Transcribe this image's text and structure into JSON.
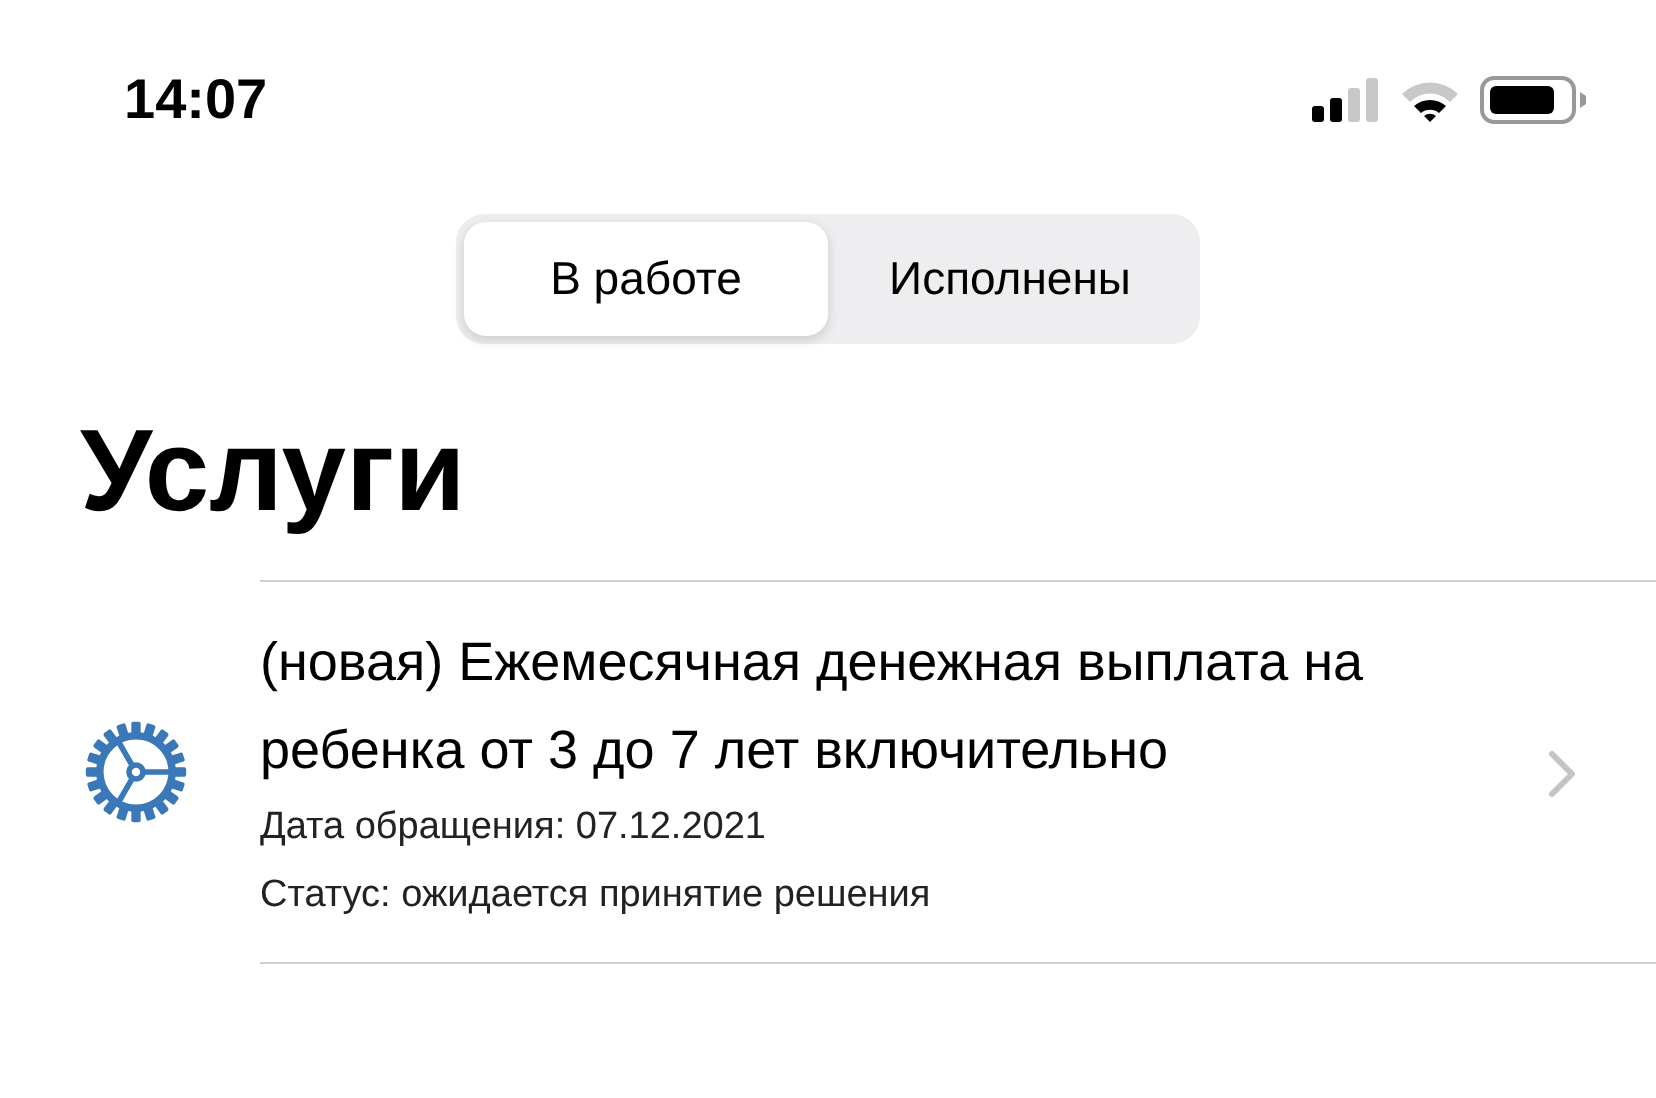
{
  "status_bar": {
    "time": "14:07"
  },
  "tabs": [
    {
      "label": "В работе",
      "selected": true
    },
    {
      "label": "Исполнены",
      "selected": false
    }
  ],
  "title": "Услуги",
  "services": [
    {
      "name": "(новая) Ежемесячная денежная выплата на ребенка от 3 до 7 лет включительно",
      "date": "Дата обращения: 07.12.2021",
      "status": "Статус: ожидается принятие решения"
    }
  ]
}
